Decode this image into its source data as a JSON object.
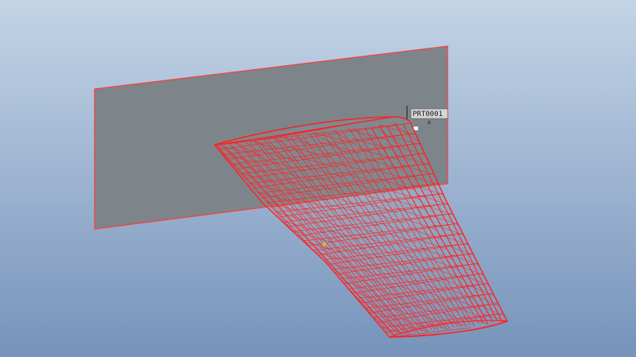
{
  "viewport": {
    "background_top": "#c3d4e6",
    "background_bottom": "#7693bb",
    "datum_plane_fill": "#7d858b",
    "datum_plane_edge": "#ff3b3b",
    "wire_color": "#ff2020",
    "highlight_color": "#b6c25a"
  },
  "csys": {
    "label": "PRT0001",
    "axis_label": "A"
  }
}
